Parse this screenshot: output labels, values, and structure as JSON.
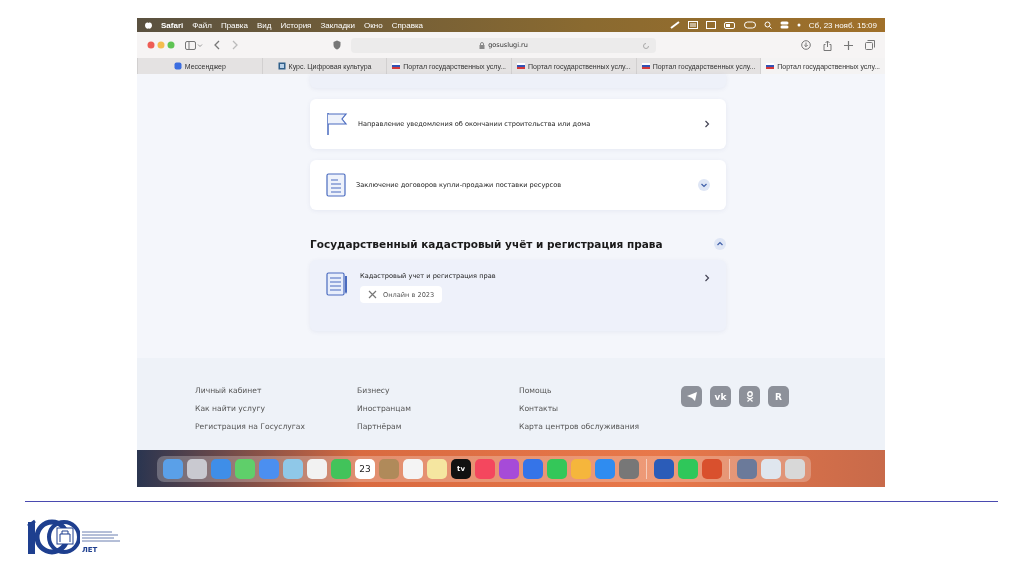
{
  "browser": {
    "menu_bar": {
      "app": "Safari",
      "items": [
        "Файл",
        "Правка",
        "Вид",
        "История",
        "Закладки",
        "Окно",
        "Справка"
      ],
      "clock": "Сб, 23 нояб. 15:09"
    },
    "address": "gosuslugi.ru",
    "tabs": [
      {
        "label": "Мессенджер",
        "selected": false
      },
      {
        "label": "Курс. Цифровая культура",
        "selected": false
      },
      {
        "label": "Портал государственных услу...",
        "selected": false
      },
      {
        "label": "Портал государственных услу...",
        "selected": false
      },
      {
        "label": "Портал государственных услу...",
        "selected": false
      },
      {
        "label": "Портал государственных услу...",
        "selected": true
      }
    ],
    "content": {
      "services": [
        {
          "title": "Направление уведомления об окончании строительства или дома",
          "kind": "link"
        },
        {
          "title": "Заключение договоров купли-продажи поставки ресурсов",
          "kind": "expand"
        }
      ],
      "section": {
        "title": "Государственный кадастровый учёт и регистрация права",
        "expanded": true,
        "items": [
          {
            "title": "Кадастровый учет и регистрация прав",
            "badge": "Онлайн в 2023"
          }
        ]
      }
    },
    "footer": {
      "columns": [
        [
          "Личный кабинет",
          "Как найти услугу",
          "Регистрация на Госуслугах"
        ],
        [
          "Бизнесу",
          "Иностранцам",
          "Партнёрам"
        ],
        [
          "Помощь",
          "Контакты",
          "Карта центров обслуживания"
        ]
      ],
      "social": [
        {
          "kind": "plane"
        },
        {
          "kind": "text",
          "label": "vk"
        },
        {
          "kind": "ok"
        },
        {
          "kind": "text",
          "label": "R"
        }
      ]
    },
    "dock": {
      "calendar_day": "23",
      "tv_label": "tv"
    }
  },
  "logo": {
    "caption": "ЛЕТ"
  }
}
